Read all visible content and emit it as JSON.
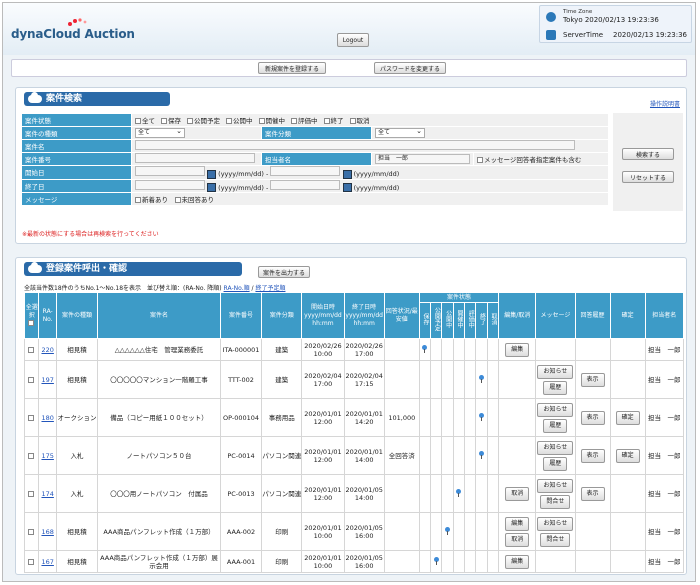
{
  "header": {
    "logo": "dynaCloud Auction",
    "logout": "Logout",
    "tz_label": "Time Zone",
    "tz_value": "Tokyo 2020/02/13 19:23:36",
    "server_label": "ServerTime",
    "server_value": "2020/02/13 19:23:36"
  },
  "topbar": {
    "register": "新規案件を登録する",
    "password": "パスワードを変更する"
  },
  "search": {
    "title": "案件検索",
    "help": "操作説明書",
    "status_label": "案件状態",
    "status_opts": [
      "全て",
      "保存",
      "公開予定",
      "公開中",
      "開催中",
      "評価中",
      "終了",
      "取消"
    ],
    "type_label": "案件の種類",
    "type_value": "全て",
    "class_label": "案件分類",
    "class_value": "全て",
    "name_label": "案件名",
    "number_label": "案件番号",
    "owner_label": "担当者名",
    "owner_value": "担当　一郎",
    "msg_only": "メッセージ回答者指定案件も含む",
    "start_label": "開始日",
    "end_label": "終了日",
    "date_fmt": "(yyyy/mm/dd)",
    "dash": "-",
    "message_label": "メッセージ",
    "msg_new": "新着あり",
    "msg_unanswered": "未回答あり",
    "search_btn": "検索する",
    "reset_btn": "リセットする",
    "note": "※最新の状態にする場合は再検索を行ってください"
  },
  "results": {
    "title": "登録案件呼出・確認",
    "export": "案件を出力する",
    "summary": "全該当件数18件のうちNo.1〜No.18を表示　並び替え順：(RA-No. 降順)",
    "sort_ra": "RA-No.順",
    "sort_sep": "/",
    "sort_end": "終了予定順",
    "headers": {
      "all": "全選択",
      "ra": "RA-No.",
      "kind": "案件の種類",
      "name": "案件名",
      "num": "案件番号",
      "cls": "案件分類",
      "start": "開始日時yyyy/mm/dd hh:mm",
      "end": "終了日時yyyy/mm/dd hh:mm",
      "ans": "回答状況/最安値",
      "state": "案件状態",
      "s_save": "保存",
      "s_plan": "公開予定",
      "s_pub": "公開中",
      "s_hold": "開催中",
      "s_eval": "評価中",
      "s_end": "終了",
      "s_cancel": "取消",
      "edit": "編集/取消",
      "msg": "メッセージ",
      "hist": "回答履歴",
      "confirm": "確定",
      "owner": "担当者名"
    },
    "rows": [
      {
        "ra": "220",
        "kind": "相見積",
        "name": "△△△△△△住宅　管理業務委託",
        "num": "ITA-000001",
        "cls": "建築",
        "start": "2020/02/26 10:00",
        "end": "2020/02/26 17:00",
        "ans": "",
        "state": 0,
        "edit": [
          "編集"
        ],
        "msg": [],
        "hist": "",
        "confirm": "",
        "owner": "担当　一郎"
      },
      {
        "ra": "197",
        "kind": "相見積",
        "name": "〇〇〇〇〇マンション一階羅工事",
        "num": "TTT-002",
        "cls": "建築",
        "start": "2020/02/04 17:00",
        "end": "2020/02/04 17:15",
        "ans": "",
        "state": 5,
        "edit": [],
        "msg": [
          "お知らせ",
          "履歴"
        ],
        "hist": "表示",
        "confirm": "",
        "owner": "担当　一郎"
      },
      {
        "ra": "180",
        "kind": "オークション",
        "name": "備品（コピー用紙１００セット）",
        "num": "OP-000104",
        "cls": "事務用品",
        "start": "2020/01/01 12:00",
        "end": "2020/01/01 14:20",
        "ans": "101,000",
        "state": 5,
        "edit": [],
        "msg": [
          "お知らせ",
          "履歴"
        ],
        "hist": "表示",
        "confirm": "確定",
        "owner": "担当　一郎"
      },
      {
        "ra": "175",
        "kind": "入札",
        "name": "ノートパソコン５０台",
        "num": "PC-0014",
        "cls": "パソコン関連",
        "start": "2020/01/01 12:00",
        "end": "2020/01/01 14:00",
        "ans": "全回答済",
        "state": 5,
        "edit": [],
        "msg": [
          "お知らせ",
          "履歴"
        ],
        "hist": "表示",
        "confirm": "確定",
        "owner": "担当　一郎"
      },
      {
        "ra": "174",
        "kind": "入札",
        "name": "〇〇〇用ノートパソコン　付属品",
        "num": "PC-0013",
        "cls": "パソコン関連",
        "start": "2020/01/01 12:00",
        "end": "2020/01/05 14:00",
        "ans": "",
        "state": 3,
        "edit": [
          "取消"
        ],
        "msg": [
          "お知らせ",
          "問合せ"
        ],
        "hist": "表示",
        "confirm": "",
        "owner": "担当　一郎"
      },
      {
        "ra": "168",
        "kind": "相見積",
        "name": "AAA商品パンフレット作成（１万部）",
        "num": "AAA-002",
        "cls": "印刷",
        "start": "2020/01/01 10:00",
        "end": "2020/01/05 16:00",
        "ans": "",
        "state": 2,
        "edit": [
          "編集",
          "取消"
        ],
        "msg": [
          "お知らせ",
          "問合せ"
        ],
        "hist": "",
        "confirm": "",
        "owner": "担当　一郎"
      },
      {
        "ra": "167",
        "kind": "相見積",
        "name": "AAA商品パンフレット作成（１万部）展示会用",
        "num": "AAA-001",
        "cls": "印刷",
        "start": "2020/01/01 10:00",
        "end": "2020/01/05 16:00",
        "ans": "",
        "state": 1,
        "edit": [
          "編集"
        ],
        "msg": [],
        "hist": "",
        "confirm": "",
        "owner": "担当　一郎"
      }
    ]
  }
}
